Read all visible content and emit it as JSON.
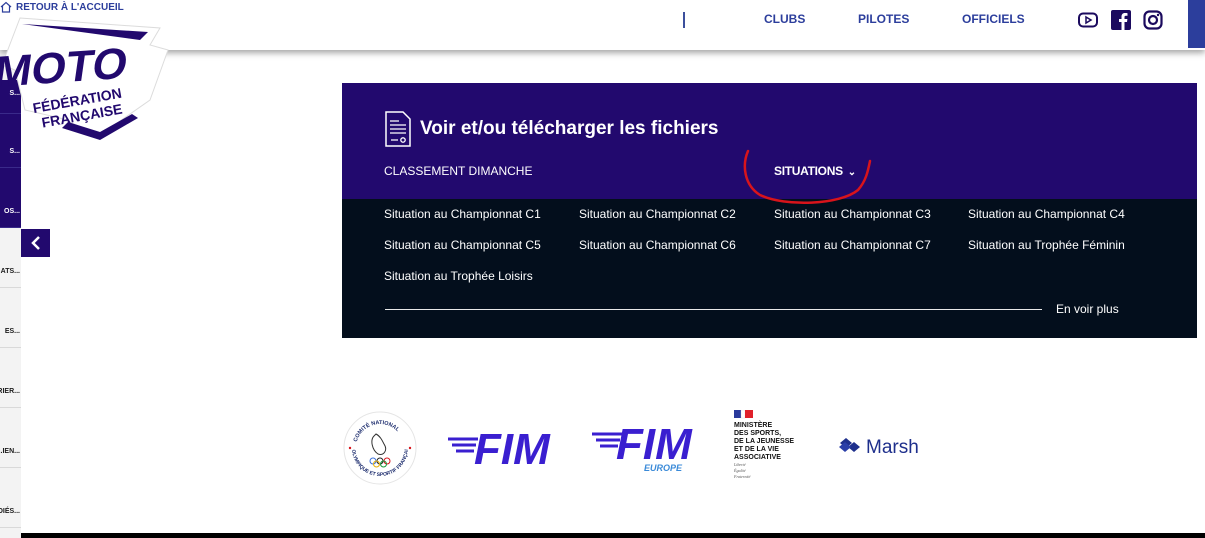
{
  "header": {
    "home_link": "RETOUR À L'ACCUEIL",
    "nav": [
      "CLUBS",
      "PILOTES",
      "OFFICIELS"
    ],
    "social_icons": [
      "youtube-icon",
      "facebook-icon",
      "instagram-icon"
    ]
  },
  "logo": {
    "main": "MOTO",
    "line1": "FÉDÉRATION",
    "line2": "FRANÇAISE"
  },
  "sidebar": {
    "items": [
      {
        "label": "...S",
        "dark": true
      },
      {
        "label": "...S",
        "dark": true
      },
      {
        "label": "...OS",
        "dark": true
      },
      {
        "label": "...ATS",
        "dark": false
      },
      {
        "label": "...ES",
        "dark": false
      },
      {
        "label": "...RIER",
        "dark": false
      },
      {
        "label": "...IEN...",
        "dark": false
      },
      {
        "label": "...DIÉS",
        "dark": false
      }
    ],
    "collapse_icon": "chevron-left-icon"
  },
  "files_panel": {
    "title": "Voir et/ou télécharger les fichiers",
    "tabs": [
      {
        "label": "CLASSEMENT DIMANCHE",
        "active": false
      },
      {
        "label": "SITUATIONS",
        "active": true
      }
    ],
    "links": [
      "Situation au Championnat C1",
      "Situation au Championnat C2",
      "Situation au Championnat C3",
      "Situation au Championnat C4",
      "Situation au Championnat C5",
      "Situation au Championnat C6",
      "Situation au Championnat C7",
      "Situation au Trophée Féminin",
      "Situation au Trophée Loisirs"
    ],
    "more_label": "En voir plus"
  },
  "partners": {
    "cnosf": {
      "top": "COMITÉ NATIONAL",
      "bottom": "OLYMPIQUE ET SPORTIF FRANÇAIS"
    },
    "fim": "FIM",
    "fim_europe": {
      "main": "FIM",
      "sub": "EUROPE"
    },
    "ministere": {
      "lines": [
        "MINISTÈRE",
        "DES SPORTS,",
        "DE LA JEUNESSE",
        "ET DE LA VIE",
        "ASSOCIATIVE"
      ],
      "motto": [
        "Liberté",
        "Égalité",
        "Fraternité"
      ]
    },
    "marsh": "Marsh"
  },
  "colors": {
    "brand_purple": "#22096e",
    "nav_blue": "#2c3e9c",
    "dark_panel": "#030e1c",
    "annotation_red": "#d8141b",
    "fim_blue": "#3a1fd0"
  }
}
